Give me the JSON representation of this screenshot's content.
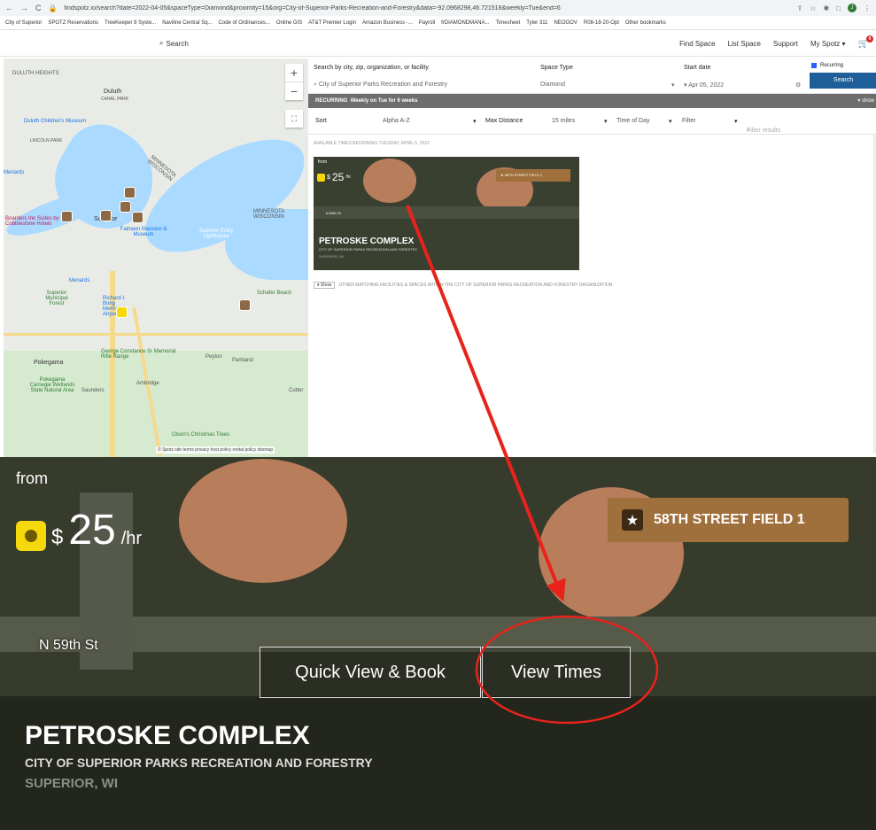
{
  "browser": {
    "url": "findspotz.io/search?date=2022-04-05&spaceType=Diamond&proximity=15&org=City-of-Superior-Parks-Recreation-and-Forestry&data=-92.0968298,46.721518&weekly=Tue&end=6",
    "bookmarks": [
      "City of Superior",
      "SPOTZ Reservations",
      "TreeKeeper 8 Syste...",
      "Naviline Central Sq...",
      "Code of Ordinances...",
      "Online GIS",
      "AT&T Premier Login",
      "Amazon Business -...",
      "Payroll",
      "frDIAMONDMANA...",
      "Timesheet",
      "Tyler 311",
      "NEOGOV",
      "R08-18-20-Opt",
      "Other bookmarks"
    ],
    "avatar": "J"
  },
  "header": {
    "search_label": "Search",
    "links": [
      "Find Space",
      "List Space",
      "Support",
      "My Spotz"
    ],
    "cart_count": "0"
  },
  "map": {
    "labels": {
      "duluth_heights": "DULUTH HEIGHTS",
      "duluth": "Duluth",
      "canal_park": "CANAL PARK",
      "childrens_museum": "Duluth Children's Museum",
      "lincoln_park": "LINCOLN PARK",
      "menards1": "Menards",
      "minnesota_wisconsin": "MINNESOTA WISCONSIN",
      "minnesota_wisconsin2": "MINNESOTA WISCONSIN",
      "hotel": "Boarders Inn Suites by Cobblestone Hotels",
      "superior": "Superior",
      "fairlawn": "Fairlawn Mansion & Museum",
      "superior_entry": "Superior Entry Lighthouse",
      "menards2": "Menards",
      "municipal_forest": "Superior Municipal Forest",
      "richard_bong": "Richard I. Bong Memorial Airport",
      "schafer_beach": "Schafer Beach",
      "rifle_range": "George Constance Sr Memorial Rifle Range",
      "peyton": "Peyton",
      "parkland": "Parkland",
      "pokegama": "Pokegama",
      "ambridge": "Ambridge",
      "pokegama_carnegie": "Pokegama Carnegie Wetlands State Natural Area",
      "saunders": "Saunders",
      "cutter": "Cutter",
      "christmas_trees": "Olson's Christmas Trees"
    },
    "footer": "© Spotz  site terms  privacy  host policy  rental policy  sitemap"
  },
  "search": {
    "location_label": "Search by city, zip, organization, or facility",
    "location_value": "City of Superior Parks Recreation and Forestry",
    "space_type_label": "Space Type",
    "space_type_value": "Diamond",
    "start_date_label": "Start date",
    "start_date_value": "Apr 05, 2022",
    "recurring_label": "Recurring",
    "search_button": "Search"
  },
  "recurring_bar": {
    "prefix": "RECURRING",
    "text": "Weekly on Tue for 6 weeks",
    "show": "▾ show"
  },
  "sort": {
    "sort_label": "Sort",
    "sort_value": "Alpha A-Z",
    "distance_label": "Max Distance",
    "distance_value": "15 miles",
    "time_label": "Time of Day",
    "filter_label": "Filter",
    "filter_placeholder": "Filter results"
  },
  "results": {
    "available_heading": "AVAILABLE TIMES BEGINNING TUESDAY, APRIL 5, 2022",
    "card": {
      "from": "from",
      "currency": "$",
      "price": "25",
      "unit": "/hr",
      "field_tag": "58TH STREET FIELD 1",
      "street": "N 59th St",
      "name": "PETROSKE COMPLEX",
      "org": "CITY OF SUPERIOR PARKS RECREATION AND FORESTRY",
      "location": "SUPERIOR, WI"
    },
    "show_button": "▾ Show",
    "other_text": "OTHER MATCHING FACILITIES & SPACES WITHIN THE CITY OF SUPERIOR PARKS RECREATION AND FORESTRY ORGANIZATION"
  },
  "zoom": {
    "quick_view": "Quick View & Book",
    "view_times": "View Times"
  },
  "colors": {
    "annotation": "#e8231c",
    "search_button": "#1f5f99",
    "field_tag": "#a0703c",
    "price_badge": "#f5d90a"
  }
}
